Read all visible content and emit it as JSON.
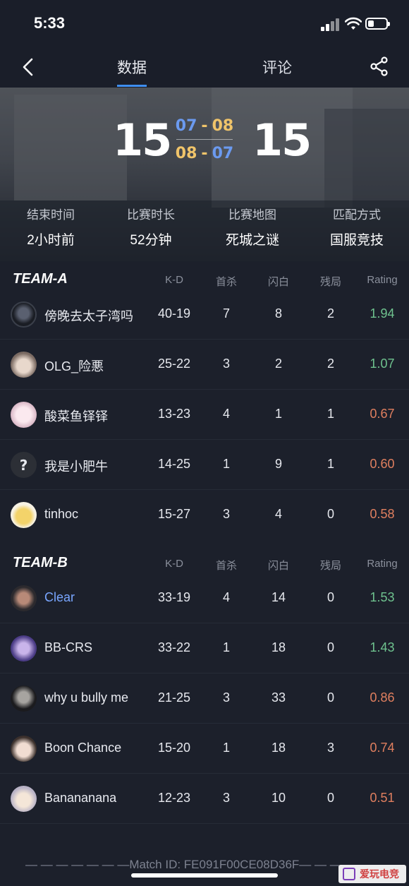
{
  "status_bar": {
    "time": "5:33"
  },
  "nav": {
    "tabs": [
      {
        "label": "数据",
        "active": true
      },
      {
        "label": "评论",
        "active": false
      }
    ]
  },
  "match": {
    "score_a": "15",
    "score_b": "15",
    "halves": [
      {
        "left": "07",
        "right": "08"
      },
      {
        "left": "08",
        "right": "07"
      }
    ],
    "info": [
      {
        "label": "结束时间",
        "value": "2小时前"
      },
      {
        "label": "比赛时长",
        "value": "52分钟"
      },
      {
        "label": "比赛地图",
        "value": "死城之谜"
      },
      {
        "label": "匹配方式",
        "value": "国服竞技"
      }
    ]
  },
  "columns": [
    "K-D",
    "首杀",
    "闪白",
    "残局",
    "Rating"
  ],
  "teams": [
    {
      "name": "TEAM-A",
      "players": [
        {
          "name": "傍晚去太子湾吗",
          "kd": "40-19",
          "first_kills": "7",
          "flashes": "8",
          "clutches": "2",
          "rating": "1.94"
        },
        {
          "name": "OLG_险悪",
          "kd": "25-22",
          "first_kills": "3",
          "flashes": "2",
          "clutches": "2",
          "rating": "1.07"
        },
        {
          "name": "酸菜鱼铎铎",
          "kd": "13-23",
          "first_kills": "4",
          "flashes": "1",
          "clutches": "1",
          "rating": "0.67"
        },
        {
          "name": "我是小肥牛",
          "kd": "14-25",
          "first_kills": "1",
          "flashes": "9",
          "clutches": "1",
          "rating": "0.60"
        },
        {
          "name": "tinhoc",
          "kd": "15-27",
          "first_kills": "3",
          "flashes": "4",
          "clutches": "0",
          "rating": "0.58"
        }
      ]
    },
    {
      "name": "TEAM-B",
      "players": [
        {
          "name": "Clear",
          "kd": "33-19",
          "first_kills": "4",
          "flashes": "14",
          "clutches": "0",
          "rating": "1.53"
        },
        {
          "name": "BB-CRS",
          "kd": "33-22",
          "first_kills": "1",
          "flashes": "18",
          "clutches": "0",
          "rating": "1.43"
        },
        {
          "name": "why u bully me",
          "kd": "21-25",
          "first_kills": "3",
          "flashes": "33",
          "clutches": "0",
          "rating": "0.86"
        },
        {
          "name": "Boon Chance",
          "kd": "15-20",
          "first_kills": "1",
          "flashes": "18",
          "clutches": "3",
          "rating": "0.74"
        },
        {
          "name": "Banananana",
          "kd": "12-23",
          "first_kills": "3",
          "flashes": "10",
          "clutches": "0",
          "rating": "0.51"
        }
      ]
    }
  ],
  "footer": {
    "match_id": "— — — — — — —Match ID: FE091F00CE08D36F— — —"
  },
  "watermark": {
    "text": "爱玩电竞"
  },
  "colors": {
    "background": "#1c202b",
    "accent": "#3f8ef0",
    "rating_good": "#6fc38f",
    "rating_bad": "#e07f5f",
    "half_blue": "#6b9af0",
    "half_gold": "#f0c46a"
  }
}
